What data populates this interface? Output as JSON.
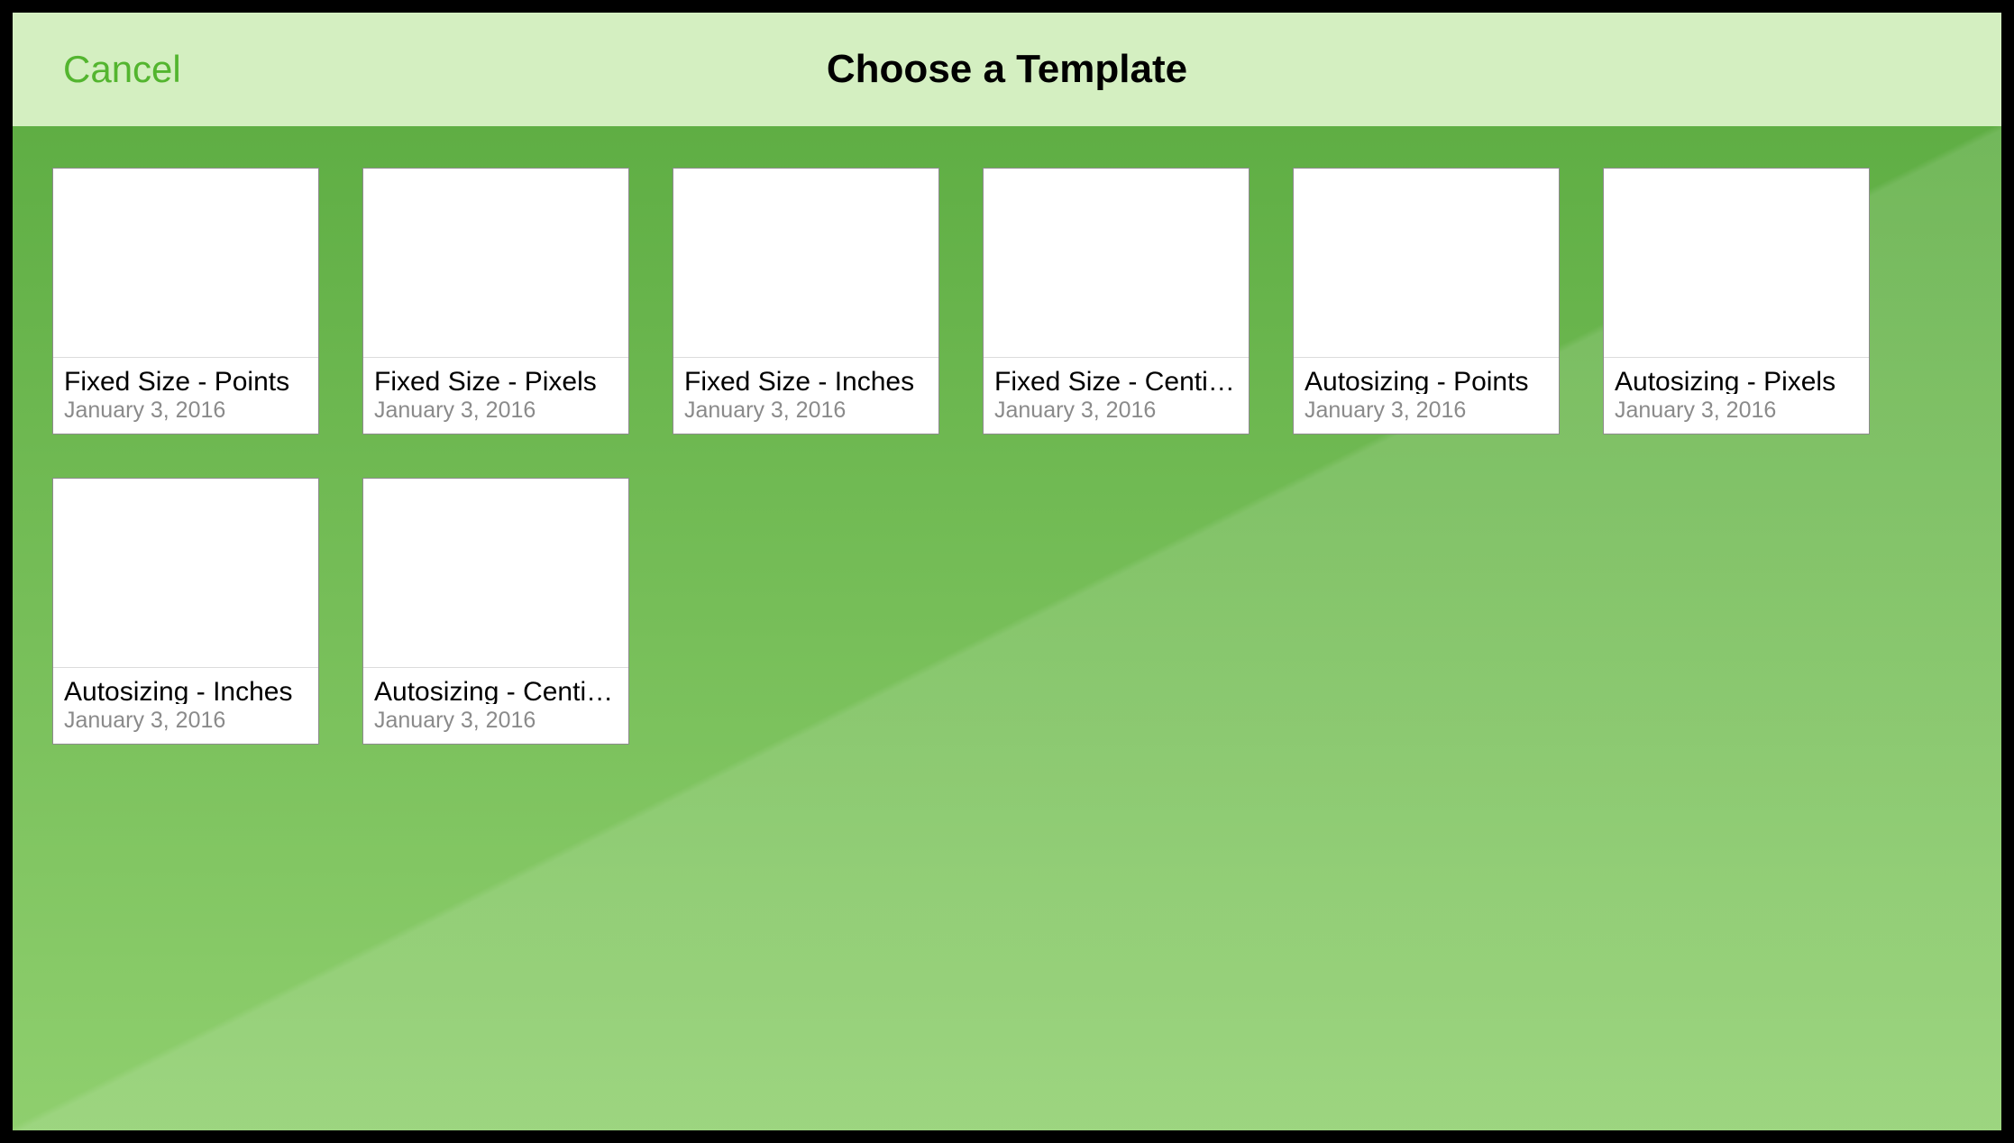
{
  "header": {
    "cancel_label": "Cancel",
    "title": "Choose a Template"
  },
  "templates": [
    {
      "name": "Fixed Size - Points",
      "date": "January 3, 2016"
    },
    {
      "name": "Fixed Size - Pixels",
      "date": "January 3, 2016"
    },
    {
      "name": "Fixed Size - Inches",
      "date": "January 3, 2016"
    },
    {
      "name": "Fixed Size - Centimeters",
      "date": "January 3, 2016"
    },
    {
      "name": "Autosizing - Points",
      "date": "January 3, 2016"
    },
    {
      "name": "Autosizing - Pixels",
      "date": "January 3, 2016"
    },
    {
      "name": "Autosizing - Inches",
      "date": "January 3, 2016"
    },
    {
      "name": "Autosizing - Centimeters",
      "date": "January 3, 2016"
    }
  ]
}
